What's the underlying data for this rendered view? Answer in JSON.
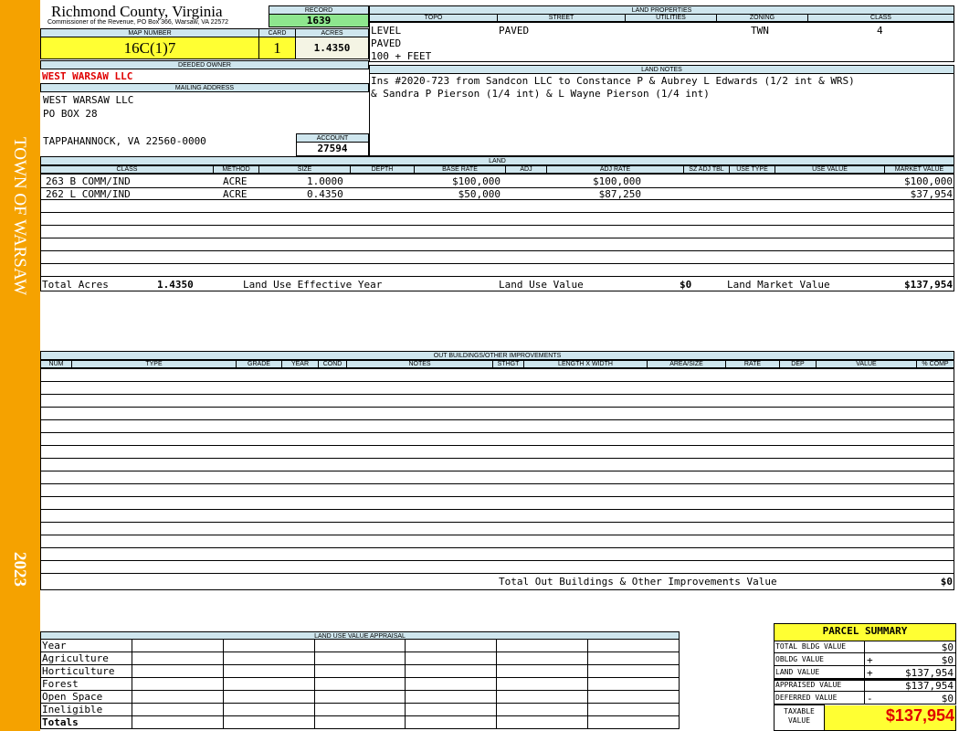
{
  "side": {
    "town": "TOWN OF WARSAW",
    "year": "2023"
  },
  "header": {
    "county": "Richmond County, Virginia",
    "commissioner": "Commissioner of the Revenue, PO Box 366, Warsaw, VA 22572",
    "record_label": "RECORD",
    "record": "1639",
    "map_label": "MAP NUMBER",
    "map": "16C(1)7",
    "card_label": "CARD",
    "card": "1",
    "acres_label": "ACRES",
    "acres": "1.4350"
  },
  "owner": {
    "deeded_label": "DEEDED OWNER",
    "deeded": "WEST WARSAW LLC",
    "mailing_label": "MAILING ADDRESS",
    "addr1": "WEST WARSAW LLC",
    "addr2": "PO BOX 28",
    "addr3": "TAPPAHANNOCK, VA 22560-0000",
    "account_label": "ACCOUNT",
    "account": "27594"
  },
  "land_props": {
    "title": "LAND PROPERTIES",
    "cols": [
      "TOPO",
      "STREET",
      "UTILITIES",
      "ZONING",
      "CLASS"
    ],
    "topo": [
      "LEVEL",
      "PAVED",
      "100 + FEET"
    ],
    "street": "PAVED",
    "zoning": "TWN",
    "class": "4"
  },
  "land_notes": {
    "title": "LAND NOTES",
    "line1": "Ins #2020-723 from Sandcon LLC to Constance P & Aubrey L Edwards (1/2 int & WRS)",
    "line2": "& Sandra P Pierson (1/4 int) & L Wayne Pierson (1/4 int)"
  },
  "land": {
    "title": "LAND",
    "cols": [
      "CLASS",
      "METHOD",
      "SIZE",
      "DEPTH",
      "BASE RATE",
      "ADJ",
      "ADJ RATE",
      "SZ ADJ TBL",
      "USE TYPE",
      "USE VALUE",
      "MARKET VALUE"
    ],
    "rows": [
      {
        "class": "263 B COMM/IND",
        "method": "ACRE",
        "size": "1.0000",
        "base": "$100,000",
        "adjrate": "$100,000",
        "market": "$100,000"
      },
      {
        "class": "262 L COMM/IND",
        "method": "ACRE",
        "size": "0.4350",
        "base": "$50,000",
        "adjrate": "$87,250",
        "market": "$37,954"
      }
    ],
    "total_acres_label": "Total Acres",
    "total_acres": "1.4350",
    "effective_label": "Land Use Effective Year",
    "use_value_label": "Land Use Value",
    "use_value": "$0",
    "market_label": "Land Market Value",
    "market": "$137,954"
  },
  "outbuildings": {
    "title": "OUT BUILDINGS/OTHER IMPROVEMENTS",
    "cols": [
      "NUM",
      "TYPE",
      "GRADE",
      "YEAR",
      "COND",
      "NOTES",
      "STHGT",
      "LENGTH X WIDTH",
      "AREA/SIZE",
      "RATE",
      "DEP",
      "VALUE",
      "% COMP"
    ],
    "total_label": "Total Out Buildings & Other Improvements Value",
    "total": "$0"
  },
  "luva": {
    "title": "LAND USE VALUE APPRAISAL",
    "rows": [
      "Year",
      "Agriculture",
      "Horticulture",
      "Forest",
      "Open Space",
      "Ineligible",
      "Totals"
    ]
  },
  "summary": {
    "title": "PARCEL SUMMARY",
    "rows": [
      {
        "label": "TOTAL BLDG VALUE",
        "sign": "",
        "value": "$0"
      },
      {
        "label": "OBLDG VALUE",
        "sign": "+",
        "value": "$0"
      },
      {
        "label": "LAND VALUE",
        "sign": "+",
        "value": "$137,954"
      },
      {
        "label": "APPRAISED VALUE",
        "sign": "",
        "value": "$137,954"
      },
      {
        "label": "DEFERRED VALUE",
        "sign": "-",
        "value": "$0"
      }
    ],
    "taxable_label1": "TAXABLE",
    "taxable_label2": "VALUE",
    "taxable": "$137,954"
  }
}
